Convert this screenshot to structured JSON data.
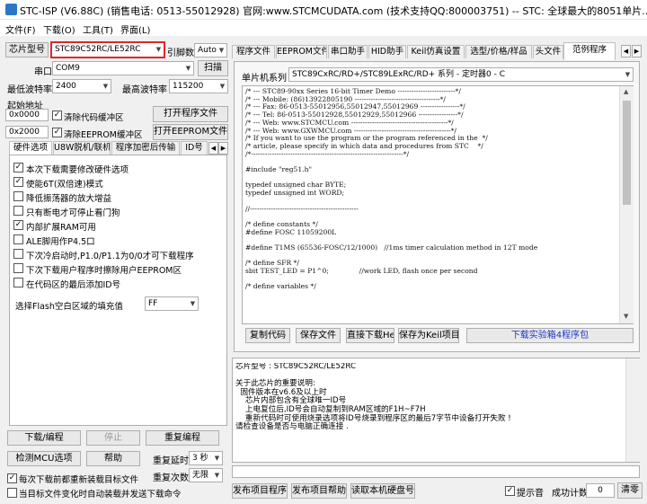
{
  "window": {
    "title": "STC-ISP (V6.88C) (销售电话: 0513-55012928) 官网:www.STCMCUDATA.com  (技术支持QQ:800003751) -- STC: 全球最大的8051单片..."
  },
  "menu": [
    "文件(F)",
    "下载(O)",
    "工具(T)",
    "界面(L)"
  ],
  "left": {
    "mcu_label": "芯片型号",
    "mcu_value": "STC89C52RC/LE52RC",
    "pin_label": "引脚数",
    "pin_value": "Auto",
    "port_label": "串口",
    "port_value": "COM9",
    "scan": "扫描",
    "min_baud_label": "最低波特率",
    "min_baud": "2400",
    "max_baud_label": "最高波特率",
    "max_baud": "115200",
    "start_addr_label": "起始地址",
    "addr1": "0x0000",
    "clear_code": "清除代码缓冲区",
    "open_prog": "打开程序文件",
    "addr2": "0x2000",
    "clear_eeprom": "清除EEPROM缓冲区",
    "open_eeprom": "打开EEPROM文件",
    "tabs": [
      "硬件选项",
      "U8W脱机/联机",
      "程序加密后传输",
      "ID号"
    ],
    "options": [
      {
        "label": "本次下载需要修改硬件选项",
        "checked": true
      },
      {
        "label": "使能6T(双倍速)模式",
        "checked": true
      },
      {
        "label": "降低振荡器的放大增益",
        "checked": false
      },
      {
        "label": "只有断电才可停止看门狗",
        "checked": false
      },
      {
        "label": "内部扩展RAM可用",
        "checked": true
      },
      {
        "label": "ALE脚用作P4.5口",
        "checked": false
      },
      {
        "label": "下次冷启动时,P1.0/P1.1为0/0才可下载程序",
        "checked": false
      },
      {
        "label": "下次下载用户程序时擦除用户EEPROM区",
        "checked": false
      },
      {
        "label": "在代码区的最后添加ID号",
        "checked": false
      }
    ],
    "fill_label": "选择Flash空白区域的填充值",
    "fill_value": "FF",
    "download": "下载/编程",
    "stop": "停止",
    "reprogram": "重复编程",
    "detect": "检测MCU选项",
    "help": "帮助",
    "delay_label": "重复延时",
    "delay_value": "3 秒",
    "reload_label": "每次下载前都重新装载目标文件",
    "reload_checked": true,
    "repeat_label": "重复次数",
    "repeat_value": "无限",
    "auto_label": "当目标文件变化时自动装载并发送下载命令",
    "auto_checked": false
  },
  "right": {
    "tabs": [
      "程序文件",
      "EEPROM文件",
      "串口助手",
      "HID助手",
      "Keil仿真设置",
      "选型/价格/样品",
      "头文件",
      "范例程序"
    ],
    "active_tab": "范例程序",
    "series_label": "单片机系列",
    "series_value": "STC89CxRC/RD+/STC89LExRC/RD+ 系列 - 定时器0 - C",
    "code": [
      "/* --- STC89-90xx Series 16-bit Timer Demo -------------------------*/",
      "/* --- Mobile: (86)13922805190 -------------------------------------*/",
      "/* --- Fax: 86-0513-55012956,55012947,55012969 -----------------*/",
      "/* --- Tel: 86-0513-55012928,55012929,55012966 -----------------*/",
      "/* --- Web: www.STCMCU.com ------------------------------------------*/",
      "/* --- Web: www.GXWMCU.com ------------------------------------------*/",
      "/* If you want to use the program or the program referenced in the  */",
      "/* article, please specify in which data and procedures from STC    */",
      "/*------------------------------------------------------------------*/",
      "",
      "#include \"reg51.h\"",
      "",
      "typedef unsigned char BYTE;",
      "typedef unsigned int WORD;",
      "",
      "//-----------------------------------------------",
      "",
      "/* define constants */",
      "#define FOSC 11059200L",
      "",
      "#define T1MS (65536-FOSC/12/1000)   //1ms timer calculation method in 12T mode",
      "",
      "/* define SFR */",
      "sbit TEST_LED = P1^0;              //work LED, flash once per second",
      "",
      "/* define variables */"
    ],
    "copy_code": "复制代码",
    "save_file": "保存文件",
    "save_hex": "直接下载Hex",
    "save_keil": "保存为Keil项目",
    "download_lib": "下载实验箱4程序包",
    "info_lines": [
      "芯片型号 : STC89C52RC/LE52RC",
      "",
      "关于此芯片的重要说明:",
      "  固件版本在v6.6及以上时",
      "    芯片内部包含有全球唯一ID号",
      "    上电复位后,ID号会自动复制到RAM区域的F1H~F7H",
      "    重新代码时可使用烧录选项将ID号烧录到程序区的最后7字节中设备打开失败 !",
      "请检查设备是否与电脑正确连接 ."
    ],
    "publish_prog": "发布项目程序",
    "publish_help": "发布项目帮助",
    "read_serial": "读取本机硬盘号",
    "beep_label": "提示音",
    "beep_checked": true,
    "success_label": "成功计数",
    "success_count": "0",
    "clear": "清零"
  }
}
